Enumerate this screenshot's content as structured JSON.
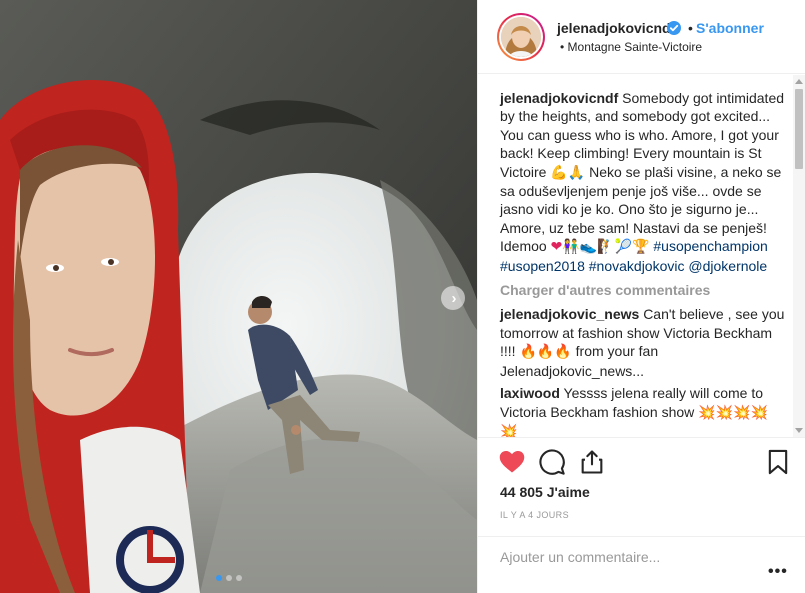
{
  "post": {
    "carousel": {
      "total": 3,
      "active": 1
    }
  },
  "header": {
    "username": "jelenadjokovicndf",
    "separator": "•",
    "follow_label": "S'abonner",
    "location_bullet": "•",
    "location": "Montagne Sainte-Victoire"
  },
  "caption": {
    "user": "jelenadjokovicndf",
    "text_1": "Somebody got intimidated by the heights, and somebody got excited... You can guess who is who. Amore, I got your back! Keep climbing! Every mountain is St Victoire",
    "emoji_1": "💪🙏",
    "text_2": "Neko se plaši visine, a neko se sa oduševljenjem penje još više... ovde se jasno vidi ko je ko. Ono što je sigurno je... Amore, uz tebe sam! Nastavi da se penješ! Idemoo",
    "emoji_2": "❤",
    "emoji_3": "👫👟🧗🎾🏆",
    "hashtags": [
      "#usopenchampion",
      "#usopen2018",
      "#novakdjokovic",
      "@djokernole"
    ]
  },
  "load_more_label": "Charger d'autres commentaires",
  "comments": [
    {
      "user": "jelenadjokovic_news",
      "text_1": "Can't believe , see you tomorrow at fashion show Victoria Beckham !!!!",
      "emoji": "🔥🔥🔥",
      "text_2": "from your fan Jelenadjokovic_news..."
    },
    {
      "user": "laxiwood",
      "text_1": "Yessss jelena really will come to Victoria Beckham fashion show",
      "emoji": "💥💥💥💥",
      "emoji_overflow": "💥"
    }
  ],
  "actions": {
    "likes": "44 805 J'aime",
    "time": "IL Y A 4 JOURS"
  },
  "add_comment": {
    "placeholder": "Ajouter un commentaire..."
  },
  "more_label": "•••",
  "carousel_next_glyph": "›",
  "colors": {
    "accent_blue": "#3897f0",
    "like_red": "#ed4956",
    "hashtag": "#003569"
  }
}
